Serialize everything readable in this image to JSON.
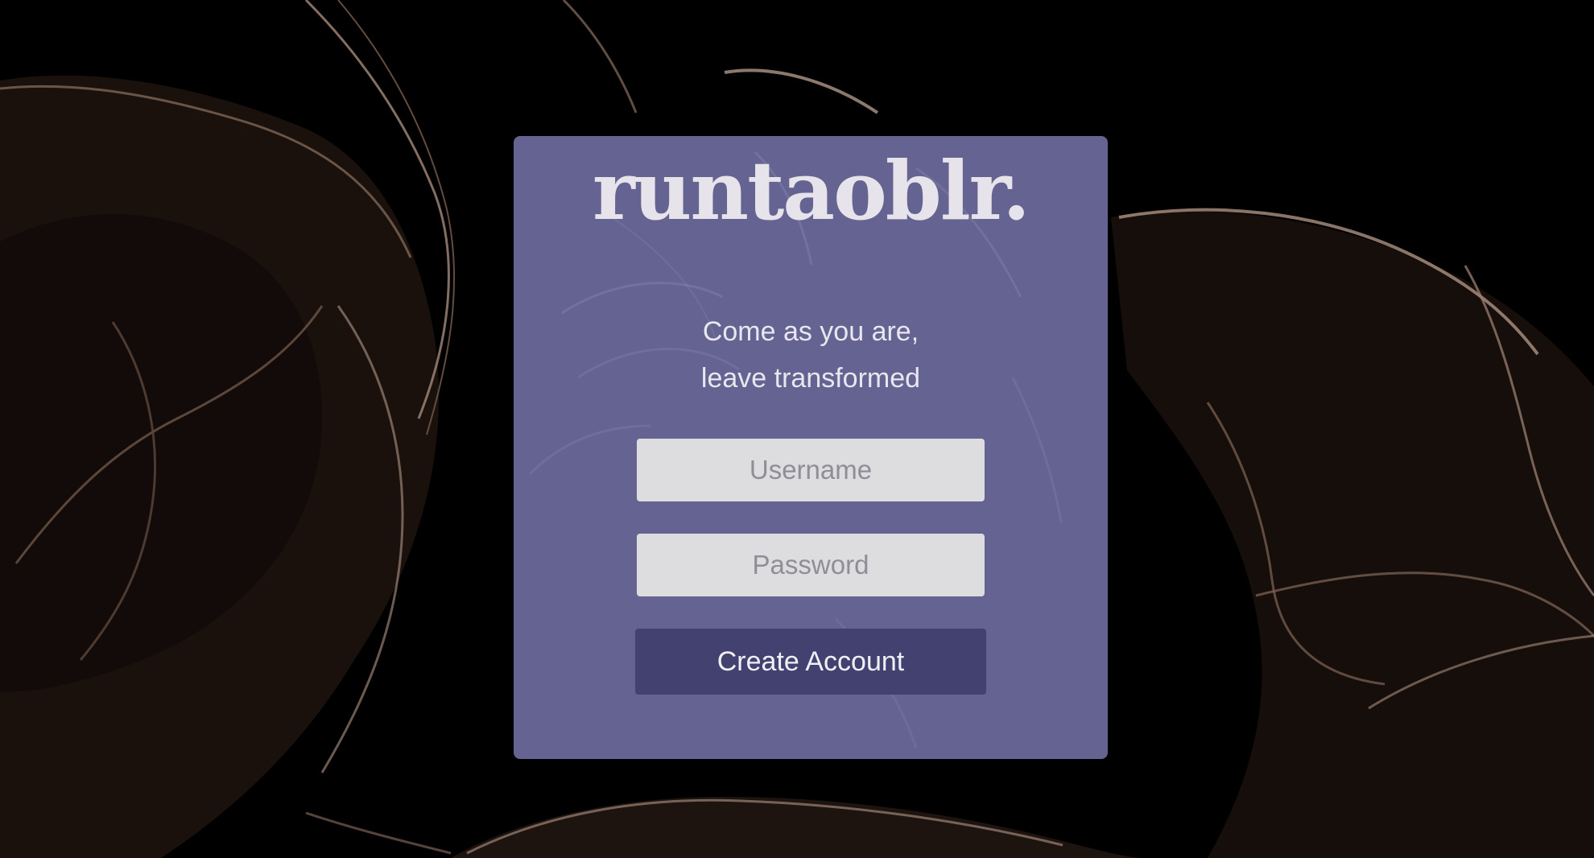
{
  "brand": {
    "logo_text": "runtaoblr."
  },
  "tagline": {
    "line1": "Come as you are,",
    "line2": "leave transformed"
  },
  "form": {
    "username_placeholder": "Username",
    "password_placeholder": "Password",
    "submit_label": "Create Account"
  },
  "colors": {
    "card_bg": "#686696",
    "button_bg": "#434170",
    "field_bg": "#dddcdf",
    "page_bg": "#000000"
  }
}
